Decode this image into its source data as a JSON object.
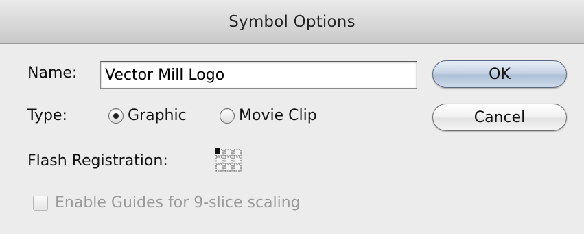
{
  "dialog": {
    "title": "Symbol Options"
  },
  "form": {
    "name_label": "Name:",
    "name_value": "Vector Mill Logo",
    "type_label": "Type:",
    "type_options": [
      {
        "label": "Graphic",
        "selected": true
      },
      {
        "label": "Movie Clip",
        "selected": false
      }
    ],
    "registration_label": "Flash Registration:",
    "registration_selected": "top-left",
    "nine_slice_label": "Enable Guides for 9-slice scaling",
    "nine_slice_checked": false,
    "nine_slice_enabled": false
  },
  "buttons": {
    "ok_label": "OK",
    "cancel_label": "Cancel"
  },
  "icons": {
    "registration_grid": "registration-point-grid-icon"
  },
  "colors": {
    "ok_button_tint": "#c7d4e6",
    "disabled_text": "#9a9a9a"
  }
}
